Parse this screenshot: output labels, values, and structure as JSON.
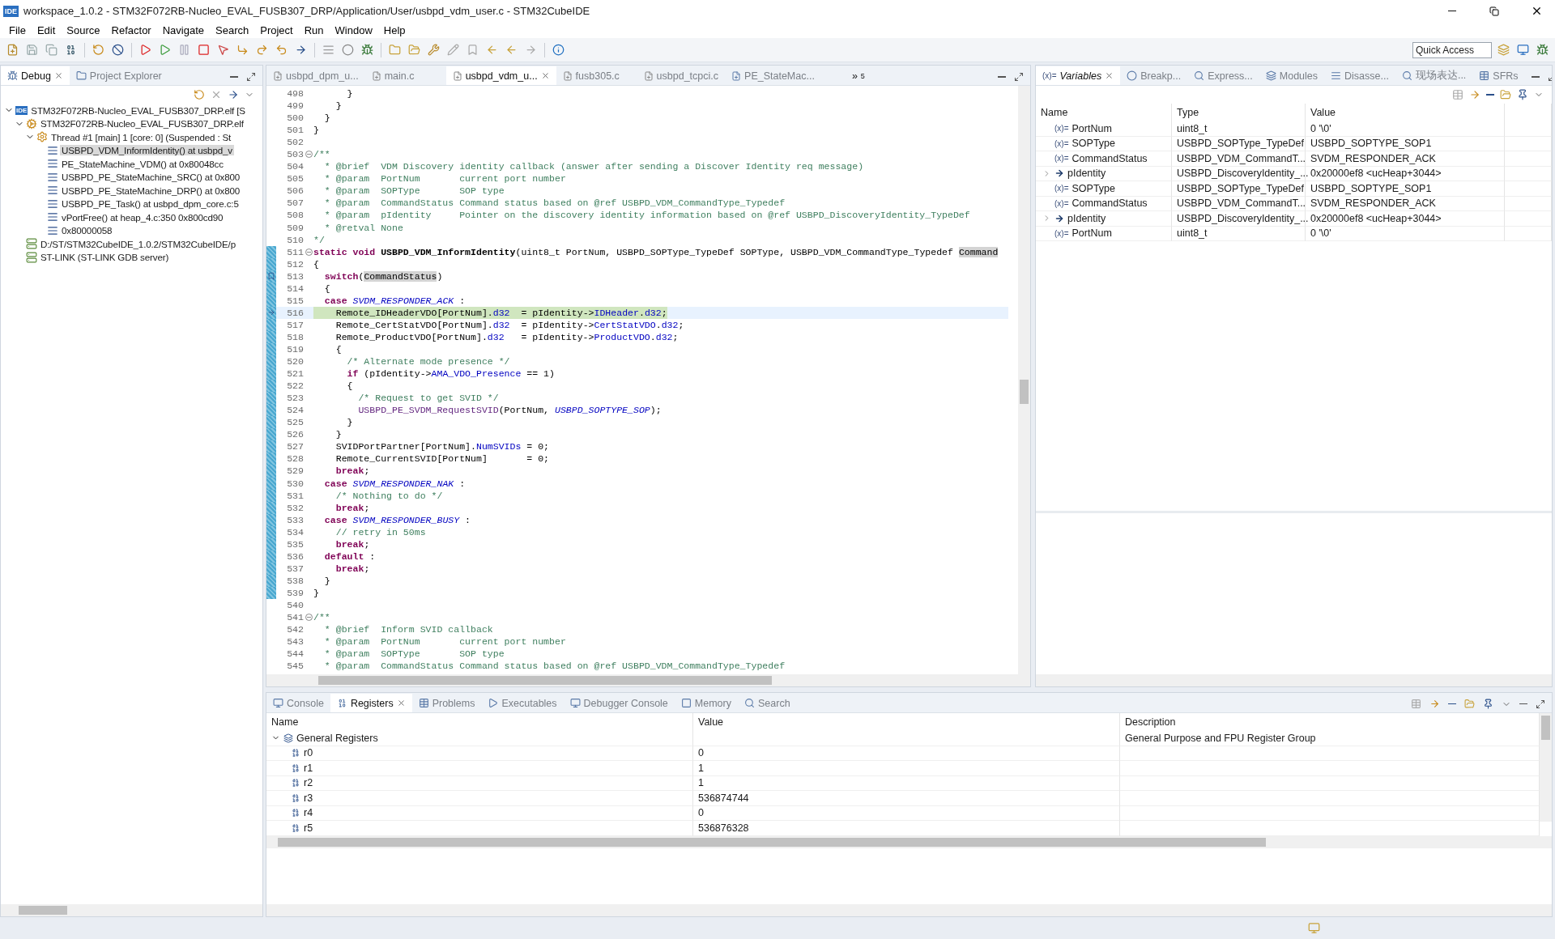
{
  "window": {
    "title": "workspace_1.0.2 - STM32F072RB-Nucleo_EVAL_FUSB307_DRP/Application/User/usbpd_vdm_user.c - STM32CubeIDE",
    "app_badge": "IDE"
  },
  "menu": [
    "File",
    "Edit",
    "Source",
    "Refactor",
    "Navigate",
    "Search",
    "Project",
    "Run",
    "Window",
    "Help"
  ],
  "quick_access": {
    "placeholder": "Quick Access"
  },
  "debug_panel": {
    "tabs": [
      {
        "label": "Debug",
        "selected": true
      },
      {
        "label": "Project Explorer",
        "selected": false
      }
    ],
    "tree": [
      {
        "kind": "launch",
        "badge": "IDE",
        "label": "STM32F072RB-Nucleo_EVAL_FUSB307_DRP.elf [S",
        "selected": false,
        "expanded": true,
        "children": [
          {
            "kind": "process",
            "label": "STM32F072RB-Nucleo_EVAL_FUSB307_DRP.elf",
            "selected": false,
            "expanded": true,
            "children": [
              {
                "kind": "thread",
                "label": "Thread #1 [main] 1 [core: 0] (Suspended : St",
                "selected": false,
                "expanded": true,
                "children": [
                  {
                    "kind": "frame",
                    "label": "USBPD_VDM_InformIdentity() at usbpd_v",
                    "selected": true
                  },
                  {
                    "kind": "frame",
                    "label": "PE_StateMachine_VDM() at 0x80048cc",
                    "selected": false
                  },
                  {
                    "kind": "frame",
                    "label": "USBPD_PE_StateMachine_SRC() at 0x800",
                    "selected": false
                  },
                  {
                    "kind": "frame",
                    "label": "USBPD_PE_StateMachine_DRP() at 0x800",
                    "selected": false
                  },
                  {
                    "kind": "frame",
                    "label": "USBPD_PE_Task() at usbpd_dpm_core.c:5",
                    "selected": false
                  },
                  {
                    "kind": "frame",
                    "label": "vPortFree() at heap_4.c:350 0x800cd90",
                    "selected": false
                  },
                  {
                    "kind": "frame",
                    "label": "0x80000058",
                    "selected": false
                  }
                ]
              }
            ]
          },
          {
            "kind": "server",
            "label": "D:/ST/STM32CubeIDE_1.0.2/STM32CubeIDE/p",
            "selected": false
          },
          {
            "kind": "server",
            "label": "ST-LINK (ST-LINK GDB server)",
            "selected": false
          }
        ]
      }
    ]
  },
  "editor": {
    "tabs": [
      {
        "label": "usbpd_dpm_u...",
        "selected": false
      },
      {
        "label": "main.c",
        "selected": false
      },
      {
        "label": "usbpd_vdm_u...",
        "selected": true
      },
      {
        "label": "fusb305.c",
        "selected": false
      },
      {
        "label": "usbpd_tcpci.c",
        "selected": false
      },
      {
        "label": "PE_StateMac...",
        "selected": false,
        "kind": "state"
      }
    ],
    "overflow": {
      "glyph": "»",
      "count": "5"
    },
    "lines": [
      {
        "n": "498",
        "bar": false,
        "fold": false,
        "current": false,
        "code": [
          {
            "kind": "plain",
            "text": "      }"
          }
        ]
      },
      {
        "n": "499",
        "bar": false,
        "fold": false,
        "current": false,
        "code": [
          {
            "kind": "plain",
            "text": "    }"
          }
        ]
      },
      {
        "n": "500",
        "bar": false,
        "fold": false,
        "current": false,
        "code": [
          {
            "kind": "plain",
            "text": "  }"
          }
        ]
      },
      {
        "n": "501",
        "bar": false,
        "fold": false,
        "current": false,
        "code": [
          {
            "kind": "plain",
            "text": "}"
          }
        ]
      },
      {
        "n": "502",
        "bar": false,
        "fold": false,
        "current": false
      },
      {
        "n": "503",
        "bar": false,
        "fold": true,
        "current": false,
        "code": [
          {
            "kind": "comment",
            "text": "/**"
          }
        ]
      },
      {
        "n": "504",
        "bar": false,
        "fold": false,
        "current": false,
        "code": [
          {
            "kind": "comment",
            "text": "  * @brief  VDM Discovery identity callback (answer after sending a Discover Identity req message)"
          }
        ]
      },
      {
        "n": "505",
        "bar": false,
        "fold": false,
        "current": false,
        "code": [
          {
            "kind": "comment",
            "text": "  * @param  PortNum       current port number"
          }
        ]
      },
      {
        "n": "506",
        "bar": false,
        "fold": false,
        "current": false,
        "code": [
          {
            "kind": "comment",
            "text": "  * @param  SOPType       SOP type"
          }
        ]
      },
      {
        "n": "507",
        "bar": false,
        "fold": false,
        "current": false,
        "code": [
          {
            "kind": "comment",
            "text": "  * @param  CommandStatus Command status based on @ref USBPD_VDM_CommandType_Typedef"
          }
        ]
      },
      {
        "n": "508",
        "bar": false,
        "fold": false,
        "current": false,
        "code": [
          {
            "kind": "comment",
            "text": "  * @param  pIdentity     Pointer on the discovery identity information based on @ref USBPD_DiscoveryIdentity_TypeDef"
          }
        ]
      },
      {
        "n": "509",
        "bar": false,
        "fold": false,
        "current": false,
        "code": [
          {
            "kind": "comment",
            "text": "  * @retval None"
          }
        ]
      },
      {
        "n": "510",
        "bar": false,
        "fold": false,
        "current": false,
        "code": [
          {
            "kind": "comment",
            "text": "*/"
          }
        ]
      },
      {
        "n": "511",
        "bar": true,
        "fold": true,
        "current": false,
        "code": [
          {
            "kind": "keyword",
            "text": "static void "
          },
          {
            "kind": "declaration",
            "text": "USBPD_VDM_InformIdentity"
          },
          {
            "kind": "plain",
            "text": "(uint8_t PortNum, USBPD_SOPType_TypeDef SOPType, USBPD_VDM_CommandType_Typedef "
          },
          {
            "kind": "occurrence",
            "text": "Command"
          }
        ]
      },
      {
        "n": "512",
        "bar": true,
        "fold": false,
        "current": false,
        "code": [
          {
            "kind": "plain",
            "text": "{"
          }
        ]
      },
      {
        "n": "513",
        "bar": true,
        "fold": false,
        "current": false,
        "kind": "bookmark",
        "code": [
          {
            "kind": "keyword",
            "text": "  switch"
          },
          {
            "kind": "plain",
            "text": "("
          },
          {
            "kind": "occurrence",
            "text": "CommandStatus"
          },
          {
            "kind": "plain",
            "text": ")"
          }
        ]
      },
      {
        "n": "514",
        "bar": true,
        "fold": false,
        "current": false,
        "code": [
          {
            "kind": "plain",
            "text": "  {"
          }
        ]
      },
      {
        "n": "515",
        "bar": true,
        "fold": false,
        "current": false,
        "code": [
          {
            "kind": "keyword",
            "text": "  case "
          },
          {
            "kind": "enum",
            "text": "SVDM_RESPONDER_ACK"
          },
          {
            "kind": "plain",
            "text": " :"
          }
        ]
      },
      {
        "n": "516",
        "bar": true,
        "fold": false,
        "current": true,
        "kind": "pointer",
        "code": [
          {
            "kind": "plain",
            "text": "    Remote_IDHeaderVDO[PortNum]."
          },
          {
            "kind": "field",
            "text": "d32"
          },
          {
            "kind": "plain",
            "text": "  = pIdentity->"
          },
          {
            "kind": "field",
            "text": "IDHeader"
          },
          {
            "kind": "plain",
            "text": "."
          },
          {
            "kind": "field",
            "text": "d32"
          },
          {
            "kind": "plain",
            "text": ";"
          }
        ]
      },
      {
        "n": "517",
        "bar": true,
        "fold": false,
        "current": false,
        "code": [
          {
            "kind": "plain",
            "text": "    Remote_CertStatVDO[PortNum]."
          },
          {
            "kind": "field",
            "text": "d32"
          },
          {
            "kind": "plain",
            "text": "  = pIdentity->"
          },
          {
            "kind": "field",
            "text": "CertStatVDO"
          },
          {
            "kind": "plain",
            "text": "."
          },
          {
            "kind": "field",
            "text": "d32"
          },
          {
            "kind": "plain",
            "text": ";"
          }
        ]
      },
      {
        "n": "518",
        "bar": true,
        "fold": false,
        "current": false,
        "code": [
          {
            "kind": "plain",
            "text": "    Remote_ProductVDO[PortNum]."
          },
          {
            "kind": "field",
            "text": "d32"
          },
          {
            "kind": "plain",
            "text": "   = pIdentity->"
          },
          {
            "kind": "field",
            "text": "ProductVDO"
          },
          {
            "kind": "plain",
            "text": "."
          },
          {
            "kind": "field",
            "text": "d32"
          },
          {
            "kind": "plain",
            "text": ";"
          }
        ]
      },
      {
        "n": "519",
        "bar": true,
        "fold": false,
        "current": false,
        "code": [
          {
            "kind": "plain",
            "text": "    {"
          }
        ]
      },
      {
        "n": "520",
        "bar": true,
        "fold": false,
        "current": false,
        "code": [
          {
            "kind": "comment",
            "text": "      /* Alternate mode presence */"
          }
        ]
      },
      {
        "n": "521",
        "bar": true,
        "fold": false,
        "current": false,
        "code": [
          {
            "kind": "keyword",
            "text": "      if"
          },
          {
            "kind": "plain",
            "text": " (pIdentity->"
          },
          {
            "kind": "field",
            "text": "AMA_VDO_Presence"
          },
          {
            "kind": "plain",
            "text": " == 1)"
          }
        ]
      },
      {
        "n": "522",
        "bar": true,
        "fold": false,
        "current": false,
        "code": [
          {
            "kind": "plain",
            "text": "      {"
          }
        ]
      },
      {
        "n": "523",
        "bar": true,
        "fold": false,
        "current": false,
        "code": [
          {
            "kind": "comment",
            "text": "        /* Request to get SVID */"
          }
        ]
      },
      {
        "n": "524",
        "bar": true,
        "fold": false,
        "current": false,
        "code": [
          {
            "kind": "call",
            "text": "        USBPD_PE_SVDM_RequestSVID"
          },
          {
            "kind": "plain",
            "text": "(PortNum, "
          },
          {
            "kind": "enum",
            "text": "USBPD_SOPTYPE_SOP"
          },
          {
            "kind": "plain",
            "text": ");"
          }
        ]
      },
      {
        "n": "525",
        "bar": true,
        "fold": false,
        "current": false,
        "code": [
          {
            "kind": "plain",
            "text": "      }"
          }
        ]
      },
      {
        "n": "526",
        "bar": true,
        "fold": false,
        "current": false,
        "code": [
          {
            "kind": "plain",
            "text": "    }"
          }
        ]
      },
      {
        "n": "527",
        "bar": true,
        "fold": false,
        "current": false,
        "code": [
          {
            "kind": "plain",
            "text": "    SVIDPortPartner[PortNum]."
          },
          {
            "kind": "field",
            "text": "NumSVIDs"
          },
          {
            "kind": "plain",
            "text": " = 0;"
          }
        ]
      },
      {
        "n": "528",
        "bar": true,
        "fold": false,
        "current": false,
        "code": [
          {
            "kind": "plain",
            "text": "    Remote_CurrentSVID[PortNum]       = 0;"
          }
        ]
      },
      {
        "n": "529",
        "bar": true,
        "fold": false,
        "current": false,
        "code": [
          {
            "kind": "keyword",
            "text": "    break"
          },
          {
            "kind": "plain",
            "text": ";"
          }
        ]
      },
      {
        "n": "530",
        "bar": true,
        "fold": false,
        "current": false,
        "code": [
          {
            "kind": "keyword",
            "text": "  case "
          },
          {
            "kind": "enum",
            "text": "SVDM_RESPONDER_NAK"
          },
          {
            "kind": "plain",
            "text": " :"
          }
        ]
      },
      {
        "n": "531",
        "bar": true,
        "fold": false,
        "current": false,
        "code": [
          {
            "kind": "comment",
            "text": "    /* Nothing to do */"
          }
        ]
      },
      {
        "n": "532",
        "bar": true,
        "fold": false,
        "current": false,
        "code": [
          {
            "kind": "keyword",
            "text": "    break"
          },
          {
            "kind": "plain",
            "text": ";"
          }
        ]
      },
      {
        "n": "533",
        "bar": true,
        "fold": false,
        "current": false,
        "code": [
          {
            "kind": "keyword",
            "text": "  case "
          },
          {
            "kind": "enum",
            "text": "SVDM_RESPONDER_BUSY"
          },
          {
            "kind": "plain",
            "text": " :"
          }
        ]
      },
      {
        "n": "534",
        "bar": true,
        "fold": false,
        "current": false,
        "code": [
          {
            "kind": "comment",
            "text": "    // retry in 50ms"
          }
        ]
      },
      {
        "n": "535",
        "bar": true,
        "fold": false,
        "current": false,
        "code": [
          {
            "kind": "keyword",
            "text": "    break"
          },
          {
            "kind": "plain",
            "text": ";"
          }
        ]
      },
      {
        "n": "536",
        "bar": true,
        "fold": false,
        "current": false,
        "code": [
          {
            "kind": "keyword",
            "text": "  default"
          },
          {
            "kind": "plain",
            "text": " :"
          }
        ]
      },
      {
        "n": "537",
        "bar": true,
        "fold": false,
        "current": false,
        "code": [
          {
            "kind": "keyword",
            "text": "    break"
          },
          {
            "kind": "plain",
            "text": ";"
          }
        ]
      },
      {
        "n": "538",
        "bar": true,
        "fold": false,
        "current": false,
        "code": [
          {
            "kind": "plain",
            "text": "  }"
          }
        ]
      },
      {
        "n": "539",
        "bar": true,
        "fold": false,
        "current": false,
        "code": [
          {
            "kind": "plain",
            "text": "}"
          }
        ]
      },
      {
        "n": "540",
        "bar": false,
        "fold": false,
        "current": false
      },
      {
        "n": "541",
        "bar": false,
        "fold": true,
        "current": false,
        "code": [
          {
            "kind": "comment",
            "text": "/**"
          }
        ]
      },
      {
        "n": "542",
        "bar": false,
        "fold": false,
        "current": false,
        "code": [
          {
            "kind": "comment",
            "text": "  * @brief  Inform SVID callback"
          }
        ]
      },
      {
        "n": "543",
        "bar": false,
        "fold": false,
        "current": false,
        "code": [
          {
            "kind": "comment",
            "text": "  * @param  PortNum       current port number"
          }
        ]
      },
      {
        "n": "544",
        "bar": false,
        "fold": false,
        "current": false,
        "code": [
          {
            "kind": "comment",
            "text": "  * @param  SOPType       SOP type"
          }
        ]
      },
      {
        "n": "545",
        "bar": false,
        "fold": false,
        "current": false,
        "code": [
          {
            "kind": "comment",
            "text": "  * @param  CommandStatus Command status based on @ref USBPD_VDM_CommandType_Typedef"
          }
        ]
      }
    ]
  },
  "variables_panel": {
    "tabs": [
      {
        "label": "Variables",
        "selected": true,
        "badge": "(x)="
      },
      {
        "label": "Breakp...",
        "selected": false
      },
      {
        "label": "Express...",
        "selected": false
      },
      {
        "label": "Modules",
        "selected": false
      },
      {
        "label": "Disasse...",
        "selected": false
      },
      {
        "label": "现场表达...",
        "selected": false
      },
      {
        "label": "SFRs",
        "selected": false
      }
    ],
    "columns": [
      "Name",
      "Type",
      "Value"
    ],
    "rows": [
      {
        "kind": "variable",
        "badge": "(x)=",
        "name": "PortNum",
        "type": "uint8_t",
        "value": "0 '\\0'"
      },
      {
        "kind": "variable",
        "badge": "(x)=",
        "name": "SOPType",
        "type": "USBPD_SOPType_TypeDef",
        "value": "USBPD_SOPTYPE_SOP1"
      },
      {
        "kind": "variable",
        "badge": "(x)=",
        "name": "CommandStatus",
        "type": "USBPD_VDM_CommandT...",
        "value": "SVDM_RESPONDER_ACK"
      },
      {
        "kind": "pointer",
        "name": "pIdentity",
        "type": "USBPD_DiscoveryIdentity_...",
        "value": "0x20000ef8 <ucHeap+3044>"
      },
      {
        "kind": "variable",
        "badge": "(x)=",
        "name": "SOPType",
        "type": "USBPD_SOPType_TypeDef",
        "value": "USBPD_SOPTYPE_SOP1"
      },
      {
        "kind": "variable",
        "badge": "(x)=",
        "name": "CommandStatus",
        "type": "USBPD_VDM_CommandT...",
        "value": "SVDM_RESPONDER_ACK"
      },
      {
        "kind": "pointer",
        "name": "pIdentity",
        "type": "USBPD_DiscoveryIdentity_...",
        "value": "0x20000ef8 <ucHeap+3044>"
      },
      {
        "kind": "variable",
        "badge": "(x)=",
        "name": "PortNum",
        "type": "uint8_t",
        "value": "0 '\\0'"
      }
    ]
  },
  "bottom_panel": {
    "tabs": [
      {
        "label": "Console",
        "selected": false
      },
      {
        "label": "Registers",
        "selected": true
      },
      {
        "label": "Problems",
        "selected": false
      },
      {
        "label": "Executables",
        "selected": false
      },
      {
        "label": "Debugger Console",
        "selected": false
      },
      {
        "label": "Memory",
        "selected": false
      },
      {
        "label": "Search",
        "selected": false
      }
    ],
    "columns": [
      "Name",
      "Value",
      "Description"
    ],
    "rows": [
      {
        "name": "General Registers",
        "description": "General Purpose and FPU Register Group",
        "expanded": true,
        "children": [
          {
            "name": "r0",
            "value": "0"
          },
          {
            "name": "r1",
            "value": "1"
          },
          {
            "name": "r2",
            "value": "1"
          },
          {
            "name": "r3",
            "value": "536874744"
          },
          {
            "name": "r4",
            "value": "0"
          },
          {
            "name": "r5",
            "value": "536876328"
          }
        ]
      }
    ]
  }
}
